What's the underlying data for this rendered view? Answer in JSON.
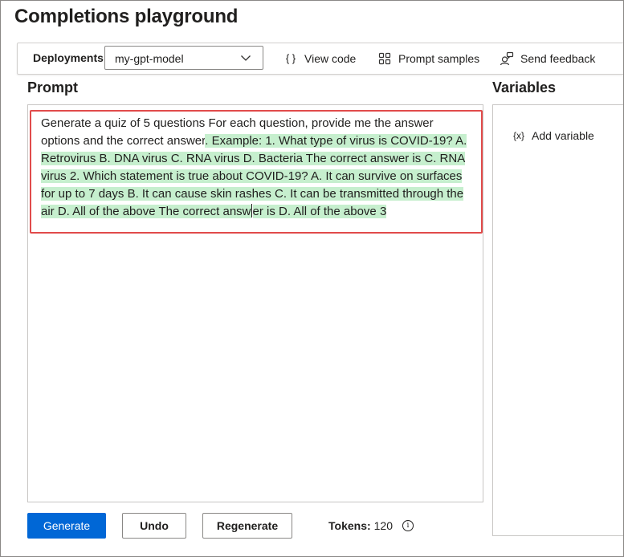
{
  "page": {
    "title": "Completions playground"
  },
  "toolbar": {
    "deployments_label": "Deployments",
    "deployment_selected": "my-gpt-model",
    "view_code_label": "View code",
    "prompt_samples_label": "Prompt samples",
    "send_feedback_label": "Send feedback",
    "icons": {
      "view_code": "braces-icon",
      "prompt_samples": "grid-icon",
      "send_feedback": "feedback-person-icon",
      "dropdown": "chevron-down-icon"
    }
  },
  "prompt": {
    "title": "Prompt",
    "text_plain": "Generate a quiz of 5 questions For each question, provide me the answer options and the correct answer",
    "text_highlighted_1": ". Example: 1. What type of virus is COVID-19? A. Retrovirus B. DNA virus C. RNA virus D. Bacteria The correct answer is C. RNA virus 2. Which statement is true about COVID-19? A. It can survive on surfaces for up to 7 days B. It can cause skin rashes C. It can be transmitted through the air D. All of the above The correct answ",
    "text_highlighted_2": "er is D. All of the above 3",
    "highlight_color": "#c6efce",
    "annotation_color": "#e14b4b"
  },
  "variables": {
    "title": "Variables",
    "add_variable_label": "Add variable",
    "add_variable_icon": "variable-braces-icon"
  },
  "actions": {
    "generate_label": "Generate",
    "undo_label": "Undo",
    "regenerate_label": "Regenerate",
    "primary_color": "#0067d6"
  },
  "tokens": {
    "label": "Tokens:",
    "value": "120",
    "info_icon": "info-icon"
  }
}
